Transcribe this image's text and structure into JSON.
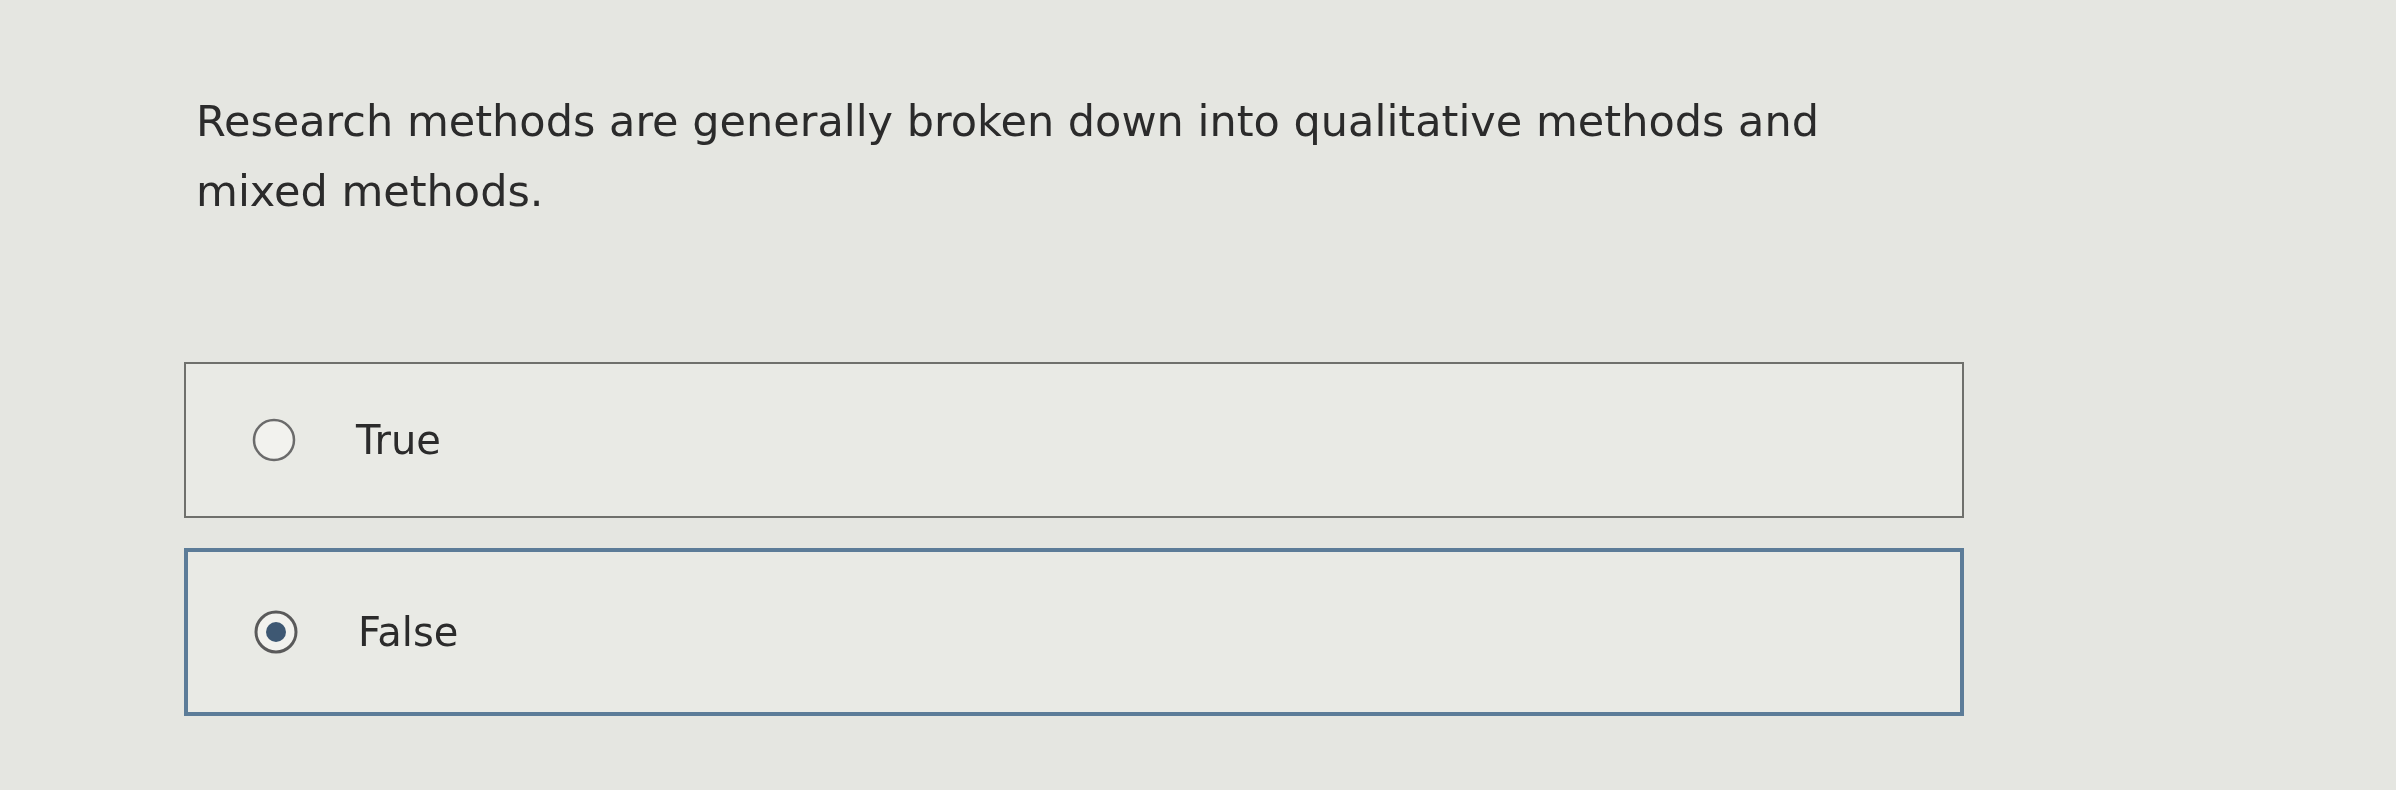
{
  "question": {
    "text": "Research methods are generally broken down into qualitative methods and mixed methods."
  },
  "options": [
    {
      "label": "True",
      "selected": false
    },
    {
      "label": "False",
      "selected": true
    }
  ]
}
